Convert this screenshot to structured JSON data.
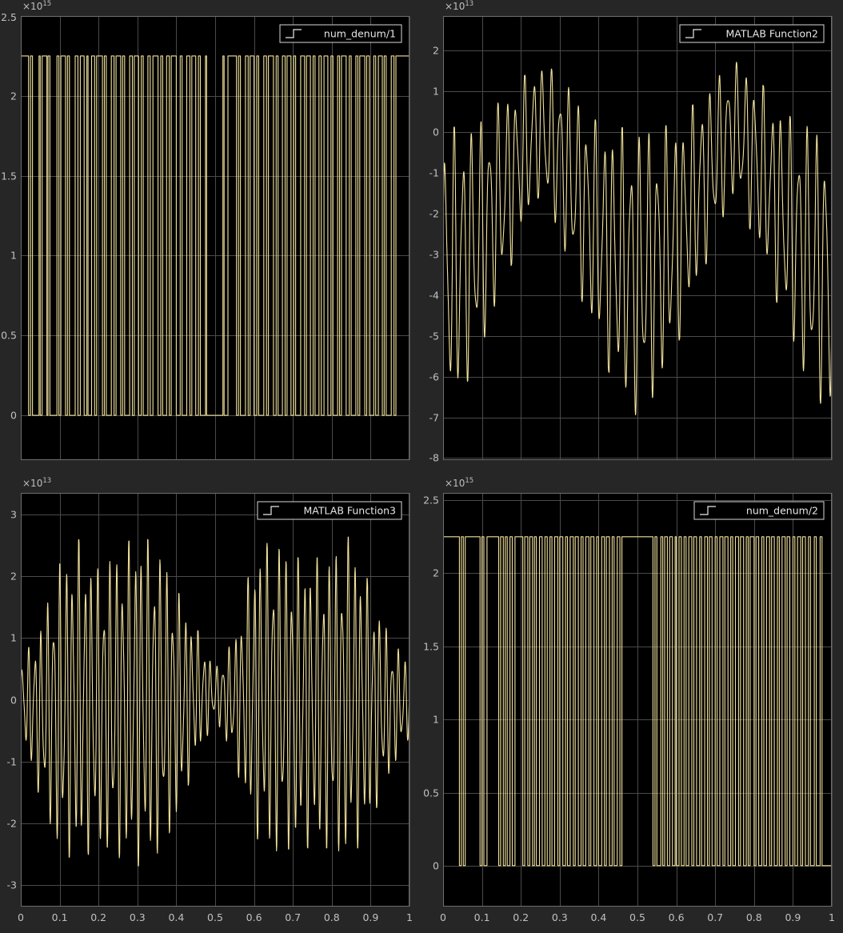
{
  "window": {
    "background_color": "#262626",
    "axes_color": "#000000",
    "trace_color": "#f2e29c",
    "grid_color": "#4a4a4a"
  },
  "chart_data": [
    {
      "type": "line",
      "name": "num_denum/1",
      "legend": "num_denum/1",
      "exponent": "15",
      "ylim": [
        -0.28,
        2.5
      ],
      "yticks": [
        "0",
        "0.5",
        "1",
        "1.5",
        "2",
        "2.5"
      ],
      "ytick_values": [
        0,
        0.5,
        1,
        1.5,
        2,
        2.5
      ],
      "xlim": [
        0,
        1
      ],
      "xticks": [],
      "grid": true,
      "legend_position": "top-right",
      "signal": "square",
      "high": 2.25,
      "low": 0.0,
      "x": [
        0,
        0.02,
        0.025,
        0.03,
        0.047,
        0.05,
        0.055,
        0.067,
        0.07,
        0.075,
        0.093,
        0.098,
        0.103,
        0.115,
        0.12,
        0.125,
        0.14,
        0.147,
        0.153,
        0.163,
        0.17,
        0.173,
        0.182,
        0.19,
        0.195,
        0.21,
        0.215,
        0.22,
        0.233,
        0.24,
        0.245,
        0.257,
        0.262,
        0.267,
        0.28,
        0.287,
        0.292,
        0.303,
        0.31,
        0.315,
        0.327,
        0.333,
        0.34,
        0.353,
        0.36,
        0.365,
        0.375,
        0.382,
        0.387,
        0.4,
        0.41,
        0.415,
        0.427,
        0.435,
        0.44,
        0.45,
        0.457,
        0.462,
        0.475,
        0.478,
        0.5,
        0.52,
        0.523,
        0.533,
        0.555,
        0.56,
        0.565,
        0.578,
        0.585,
        0.59,
        0.6,
        0.607,
        0.612,
        0.625,
        0.632,
        0.637,
        0.65,
        0.657,
        0.662,
        0.673,
        0.68,
        0.685,
        0.695,
        0.702,
        0.707,
        0.72,
        0.73,
        0.735,
        0.745,
        0.752,
        0.757,
        0.767,
        0.773,
        0.78,
        0.79,
        0.798,
        0.803,
        0.815,
        0.82,
        0.825,
        0.837,
        0.845,
        0.85,
        0.862,
        0.867,
        0.872,
        0.885,
        0.89,
        0.897,
        0.908,
        0.913,
        0.92,
        0.93,
        0.935,
        0.94,
        0.953,
        0.96,
        0.965,
        0.975,
        1
      ],
      "levels": [
        1,
        0,
        1,
        0,
        1,
        0,
        1,
        0,
        1,
        0,
        1,
        0,
        1,
        0,
        1,
        0,
        1,
        0,
        1,
        0,
        1,
        0,
        1,
        0,
        1,
        0,
        1,
        0,
        1,
        0,
        1,
        0,
        1,
        0,
        1,
        0,
        1,
        0,
        1,
        0,
        1,
        0,
        1,
        0,
        1,
        0,
        1,
        0,
        1,
        0,
        1,
        0,
        1,
        0,
        1,
        0,
        1,
        0,
        1,
        0,
        0,
        1,
        0,
        1,
        0,
        1,
        0,
        1,
        0,
        1,
        0,
        1,
        0,
        1,
        0,
        1,
        0,
        1,
        0,
        1,
        0,
        1,
        0,
        1,
        0,
        1,
        0,
        1,
        0,
        1,
        0,
        1,
        0,
        1,
        0,
        1,
        0,
        1,
        0,
        1,
        0,
        1,
        0,
        1,
        0,
        1,
        0,
        1,
        0,
        1,
        0,
        1,
        0,
        1,
        0,
        1,
        0,
        1,
        1
      ]
    },
    {
      "type": "line",
      "name": "MATLAB Function2",
      "legend": "MATLAB Function2",
      "exponent": "13",
      "ylim": [
        -8.05,
        2.85
      ],
      "yticks": [
        "-8",
        "-7",
        "-6",
        "-5",
        "-4",
        "-3",
        "-2",
        "-1",
        "0",
        "1",
        "2"
      ],
      "ytick_values": [
        -8,
        -7,
        -6,
        -5,
        -4,
        -3,
        -2,
        -1,
        0,
        1,
        2
      ],
      "xlim": [
        0,
        1
      ],
      "xticks": [],
      "grid": true,
      "legend_position": "top-right",
      "signal": "oscillation",
      "envelope": {
        "upper": [
          [
            0,
            0.05
          ],
          [
            0.1,
            0.3
          ],
          [
            0.2,
            1.3
          ],
          [
            0.25,
            1.75
          ],
          [
            0.3,
            1.4
          ],
          [
            0.4,
            0.2
          ],
          [
            0.5,
            0.05
          ],
          [
            0.6,
            0.2
          ],
          [
            0.7,
            1.3
          ],
          [
            0.75,
            1.75
          ],
          [
            0.8,
            1.4
          ],
          [
            0.9,
            0.3
          ],
          [
            1,
            0.05
          ]
        ],
        "lower": [
          [
            0,
            -7.0
          ],
          [
            0.05,
            -6.4
          ],
          [
            0.1,
            -5.3
          ],
          [
            0.2,
            -2.6
          ],
          [
            0.25,
            -1.5
          ],
          [
            0.3,
            -2.6
          ],
          [
            0.4,
            -5.3
          ],
          [
            0.45,
            -6.4
          ],
          [
            0.5,
            -7.0
          ],
          [
            0.55,
            -6.4
          ],
          [
            0.6,
            -5.3
          ],
          [
            0.7,
            -2.6
          ],
          [
            0.75,
            -1.5
          ],
          [
            0.8,
            -2.6
          ],
          [
            0.9,
            -5.3
          ],
          [
            0.95,
            -6.4
          ],
          [
            1,
            -7.0
          ]
        ]
      },
      "cycles": 44
    },
    {
      "type": "line",
      "name": "MATLAB Function3",
      "legend": "MATLAB Function3",
      "exponent": "13",
      "ylim": [
        -3.35,
        3.35
      ],
      "yticks": [
        "-3",
        "-2",
        "-1",
        "0",
        "1",
        "2",
        "3"
      ],
      "ytick_values": [
        -3,
        -2,
        -1,
        0,
        1,
        2,
        3
      ],
      "xlim": [
        0,
        1
      ],
      "xticks": [
        "0",
        "0.1",
        "0.2",
        "0.3",
        "0.4",
        "0.5",
        "0.6",
        "0.7",
        "0.8",
        "0.9",
        "1"
      ],
      "xtick_values": [
        0,
        0.1,
        0.2,
        0.3,
        0.4,
        0.5,
        0.6,
        0.7,
        0.8,
        0.9,
        1
      ],
      "grid": true,
      "legend_position": "top-right",
      "signal": "oscillation",
      "envelope": {
        "upper": [
          [
            0,
            0.6
          ],
          [
            0.05,
            1.2
          ],
          [
            0.1,
            2.2
          ],
          [
            0.15,
            2.6
          ],
          [
            0.2,
            2.1
          ],
          [
            0.3,
            2.7
          ],
          [
            0.35,
            2.5
          ],
          [
            0.4,
            1.8
          ],
          [
            0.45,
            1.2
          ],
          [
            0.5,
            0.5
          ],
          [
            0.55,
            1.0
          ],
          [
            0.6,
            2.4
          ],
          [
            0.65,
            2.6
          ],
          [
            0.7,
            2.3
          ],
          [
            0.8,
            2.3
          ],
          [
            0.85,
            2.7
          ],
          [
            0.9,
            1.8
          ],
          [
            0.95,
            1.0
          ],
          [
            1,
            0.6
          ]
        ],
        "lower": [
          [
            0,
            -0.6
          ],
          [
            0.05,
            -1.6
          ],
          [
            0.1,
            -2.5
          ],
          [
            0.15,
            -2.6
          ],
          [
            0.2,
            -2.4
          ],
          [
            0.3,
            -2.7
          ],
          [
            0.35,
            -2.5
          ],
          [
            0.4,
            -2.0
          ],
          [
            0.45,
            -1.0
          ],
          [
            0.5,
            -0.3
          ],
          [
            0.55,
            -1.0
          ],
          [
            0.6,
            -2.2
          ],
          [
            0.65,
            -2.5
          ],
          [
            0.7,
            -2.4
          ],
          [
            0.8,
            -2.4
          ],
          [
            0.85,
            -2.6
          ],
          [
            0.9,
            -2.0
          ],
          [
            0.95,
            -1.2
          ],
          [
            1,
            -0.6
          ]
        ]
      },
      "cycles": 62
    },
    {
      "type": "line",
      "name": "num_denum/2",
      "legend": "num_denum/2",
      "exponent": "15",
      "ylim": [
        -0.28,
        2.55
      ],
      "yticks": [
        "0",
        "0.5",
        "1",
        "1.5",
        "2",
        "2.5"
      ],
      "ytick_values": [
        0,
        0.5,
        1,
        1.5,
        2,
        2.5
      ],
      "xlim": [
        0,
        1
      ],
      "xticks": [
        "0",
        "0.1",
        "0.2",
        "0.3",
        "0.4",
        "0.5",
        "0.6",
        "0.7",
        "0.8",
        "0.9",
        "1"
      ],
      "xtick_values": [
        0,
        0.1,
        0.2,
        0.3,
        0.4,
        0.5,
        0.6,
        0.7,
        0.8,
        0.9,
        1
      ],
      "grid": true,
      "legend_position": "top-right",
      "signal": "square",
      "high": 2.25,
      "low": 0.0,
      "x": [
        0,
        0.042,
        0.047,
        0.052,
        0.057,
        0.095,
        0.1,
        0.105,
        0.113,
        0.143,
        0.148,
        0.155,
        0.16,
        0.165,
        0.172,
        0.178,
        0.185,
        0.205,
        0.21,
        0.218,
        0.223,
        0.23,
        0.235,
        0.24,
        0.248,
        0.255,
        0.262,
        0.268,
        0.275,
        0.28,
        0.287,
        0.295,
        0.3,
        0.308,
        0.315,
        0.32,
        0.327,
        0.335,
        0.34,
        0.348,
        0.355,
        0.36,
        0.367,
        0.375,
        0.38,
        0.388,
        0.395,
        0.4,
        0.408,
        0.415,
        0.42,
        0.428,
        0.435,
        0.44,
        0.448,
        0.455,
        0.46,
        0.535,
        0.54,
        0.545,
        0.55,
        0.56,
        0.565,
        0.57,
        0.577,
        0.583,
        0.59,
        0.597,
        0.6,
        0.607,
        0.613,
        0.62,
        0.625,
        0.632,
        0.64,
        0.645,
        0.652,
        0.66,
        0.665,
        0.673,
        0.68,
        0.685,
        0.692,
        0.7,
        0.705,
        0.712,
        0.72,
        0.725,
        0.733,
        0.74,
        0.745,
        0.752,
        0.76,
        0.765,
        0.773,
        0.78,
        0.785,
        0.79,
        0.8,
        0.805,
        0.812,
        0.82,
        0.825,
        0.832,
        0.84,
        0.845,
        0.852,
        0.86,
        0.865,
        0.872,
        0.88,
        0.885,
        0.892,
        0.9,
        0.905,
        0.912,
        0.92,
        0.925,
        0.932,
        0.94,
        0.945,
        0.955,
        0.96,
        0.97,
        0.975,
        1
      ],
      "levels": [
        1,
        0,
        1,
        0,
        1,
        0,
        1,
        0,
        1,
        0,
        1,
        0,
        1,
        0,
        1,
        0,
        1,
        0,
        1,
        0,
        1,
        0,
        1,
        0,
        1,
        0,
        1,
        0,
        1,
        0,
        1,
        0,
        1,
        0,
        1,
        0,
        1,
        0,
        1,
        0,
        1,
        0,
        1,
        0,
        1,
        0,
        1,
        0,
        1,
        0,
        1,
        0,
        1,
        0,
        1,
        0,
        1,
        1,
        0,
        1,
        0,
        1,
        0,
        1,
        0,
        1,
        0,
        1,
        0,
        1,
        0,
        1,
        0,
        1,
        0,
        1,
        0,
        1,
        0,
        1,
        0,
        1,
        0,
        1,
        0,
        1,
        0,
        1,
        0,
        1,
        0,
        1,
        0,
        1,
        0,
        1,
        0,
        1,
        0,
        1,
        0,
        1,
        0,
        1,
        0,
        1,
        0,
        1,
        0,
        1,
        0,
        1,
        0,
        1,
        0,
        1,
        0,
        1,
        0,
        1,
        0,
        1,
        0,
        1,
        0,
        1,
        1
      ]
    }
  ]
}
